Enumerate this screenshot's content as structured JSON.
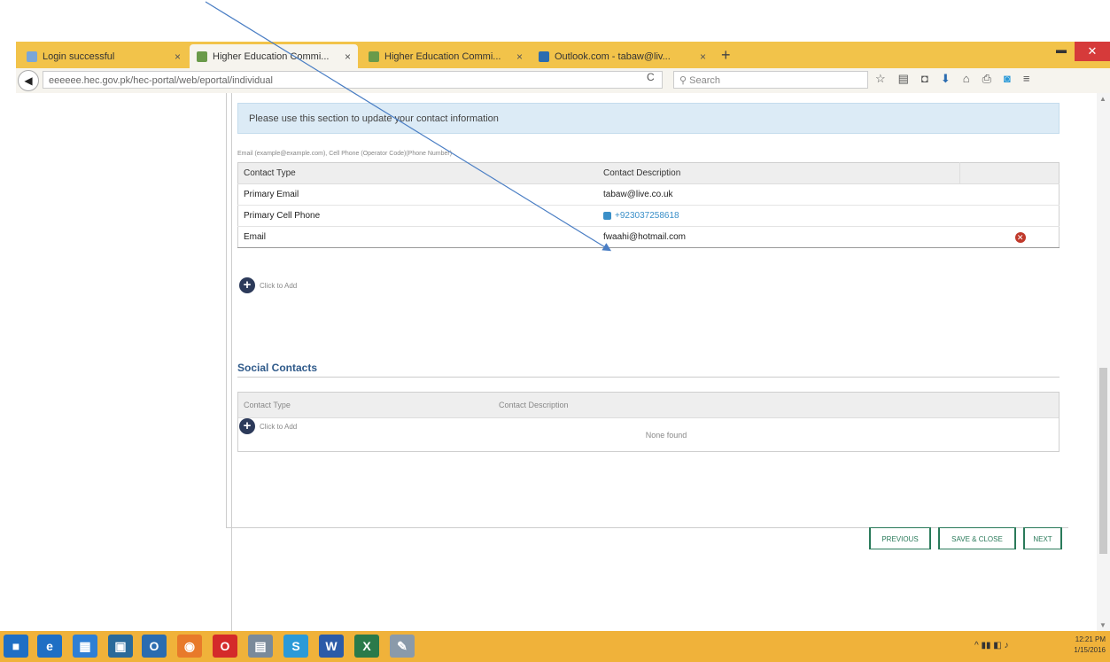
{
  "browser": {
    "tabs": [
      {
        "title": "Login successful",
        "active": false,
        "favicon_color": "#7aa6d8"
      },
      {
        "title": "Higher Education Commi...",
        "active": true,
        "favicon_color": "#6a9a4a"
      },
      {
        "title": "Higher Education Commi...",
        "active": false,
        "favicon_color": "#6a9a4a"
      },
      {
        "title": "Outlook.com - tabaw@liv...",
        "active": false,
        "favicon_color": "#2b6cb0"
      }
    ],
    "tab_close_glyph": "×",
    "new_tab_glyph": "+",
    "url": "eeeeee.hec.gov.pk/hec-portal/web/eportal/individual",
    "url_domain": "hec.gov.pk",
    "search_placeholder": "Search",
    "reload_glyph": "C"
  },
  "page": {
    "info_text": "Please use this section to update your contact information",
    "hint_text": "Email (example@example.com), Cell Phone (Operator Code)(Phone Number)",
    "contacts": {
      "headers": [
        "Contact Type",
        "Contact Description"
      ],
      "rows": [
        {
          "type": "Primary Email",
          "description": "tabaw@live.co.uk"
        },
        {
          "type": "Primary Cell Phone",
          "description": "+923037258618"
        },
        {
          "type": "Email",
          "description": "fwaahi@hotmail.com"
        }
      ],
      "add_label": "Click to Add"
    },
    "social": {
      "title": "Social Contacts",
      "headers": [
        "Contact Type",
        "Contact Description"
      ],
      "empty_text": "None found",
      "add_label": "Click to Add"
    },
    "buttons": {
      "previous": "PREVIOUS",
      "save_close": "SAVE & CLOSE",
      "next": "NEXT"
    }
  },
  "taskbar": {
    "clock_time": "12:21 PM",
    "clock_date": "1/15/2016"
  },
  "colors": {
    "tabbar": "#f2c34a",
    "taskbar": "#f0b23a",
    "info_bg": "#dcebf6",
    "accent_green": "#2a7a5a",
    "link_blue": "#3a8fc8",
    "arrow": "#4a7ec4"
  }
}
